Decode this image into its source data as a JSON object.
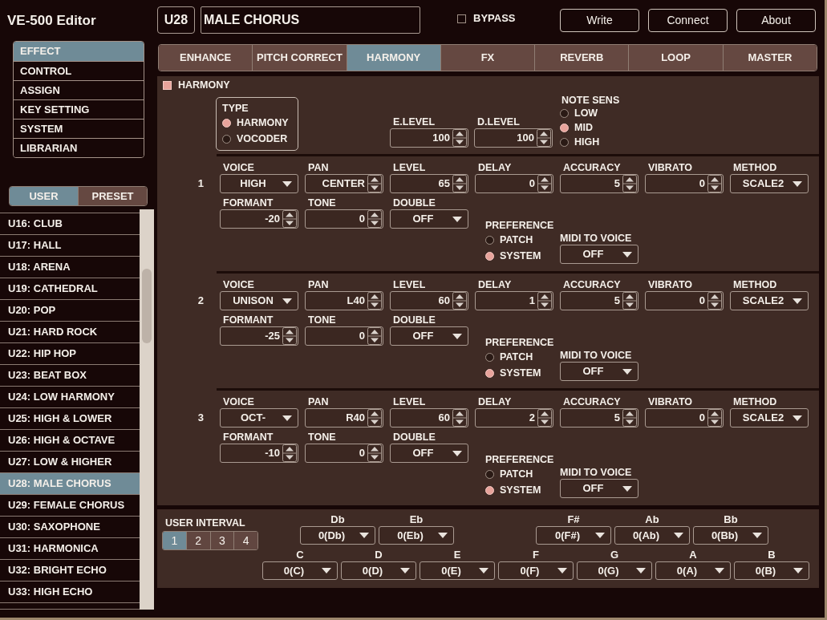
{
  "app": {
    "title": "VE-500 Editor"
  },
  "menu": [
    {
      "label": "EFFECT",
      "selected": true
    },
    {
      "label": "CONTROL",
      "selected": false
    },
    {
      "label": "ASSIGN",
      "selected": false
    },
    {
      "label": "KEY SETTING",
      "selected": false
    },
    {
      "label": "SYSTEM",
      "selected": false
    },
    {
      "label": "LIBRARIAN",
      "selected": false
    }
  ],
  "bank_tabs": [
    {
      "label": "USER",
      "selected": true
    },
    {
      "label": "PRESET",
      "selected": false
    }
  ],
  "patches": [
    {
      "label": "U16: CLUB",
      "selected": false
    },
    {
      "label": "U17: HALL",
      "selected": false
    },
    {
      "label": "U18: ARENA",
      "selected": false
    },
    {
      "label": "U19: CATHEDRAL",
      "selected": false
    },
    {
      "label": "U20: POP",
      "selected": false
    },
    {
      "label": "U21: HARD ROCK",
      "selected": false
    },
    {
      "label": "U22: HIP HOP",
      "selected": false
    },
    {
      "label": "U23: BEAT BOX",
      "selected": false
    },
    {
      "label": "U24: LOW HARMONY",
      "selected": false
    },
    {
      "label": "U25: HIGH & LOWER",
      "selected": false
    },
    {
      "label": "U26: HIGH & OCTAVE",
      "selected": false
    },
    {
      "label": "U27: LOW & HIGHER",
      "selected": false
    },
    {
      "label": "U28: MALE CHORUS",
      "selected": true
    },
    {
      "label": "U29: FEMALE CHORUS",
      "selected": false
    },
    {
      "label": "U30: SAXOPHONE",
      "selected": false
    },
    {
      "label": "U31: HARMONICA",
      "selected": false
    },
    {
      "label": "U32: BRIGHT ECHO",
      "selected": false
    },
    {
      "label": "U33: HIGH ECHO",
      "selected": false
    }
  ],
  "patch": {
    "number": "U28",
    "name": "MALE CHORUS"
  },
  "bypass": {
    "label": "BYPASS",
    "checked": false
  },
  "buttons": [
    "Write",
    "Connect",
    "About"
  ],
  "tabs": [
    {
      "label": "ENHANCE",
      "selected": false
    },
    {
      "label": "PITCH CORRECT",
      "selected": false
    },
    {
      "label": "HARMONY",
      "selected": true
    },
    {
      "label": "FX",
      "selected": false
    },
    {
      "label": "REVERB",
      "selected": false
    },
    {
      "label": "LOOP",
      "selected": false
    },
    {
      "label": "MASTER",
      "selected": false
    }
  ],
  "harmony": {
    "label": "HARMONY",
    "on": true,
    "type": {
      "label": "TYPE",
      "options": [
        {
          "label": "HARMONY",
          "selected": true
        },
        {
          "label": "VOCODER",
          "selected": false
        }
      ]
    },
    "e_level": {
      "label": "E.LEVEL",
      "value": "100"
    },
    "d_level": {
      "label": "D.LEVEL",
      "value": "100"
    },
    "note_sens": {
      "label": "NOTE SENS",
      "options": [
        {
          "label": "LOW",
          "selected": false
        },
        {
          "label": "MID",
          "selected": true
        },
        {
          "label": "HIGH",
          "selected": false
        }
      ]
    },
    "voices": [
      {
        "number": "1",
        "row_1": [
          {
            "label": "VOICE",
            "value": "HIGH",
            "kind": "dropdown"
          },
          {
            "label": "PAN",
            "value": "CENTER",
            "kind": "stepper"
          },
          {
            "label": "LEVEL",
            "value": "65",
            "kind": "stepper"
          },
          {
            "label": "DELAY",
            "value": "0",
            "kind": "stepper"
          },
          {
            "label": "ACCURACY",
            "value": "5",
            "kind": "stepper"
          },
          {
            "label": "VIBRATO",
            "value": "0",
            "kind": "stepper"
          },
          {
            "label": "METHOD",
            "value": "SCALE2",
            "kind": "dropdown"
          }
        ],
        "row_2": [
          {
            "label": "FORMANT",
            "value": "-20",
            "kind": "stepper"
          },
          {
            "label": "TONE",
            "value": "0",
            "kind": "stepper"
          },
          {
            "label": "DOUBLE",
            "value": "OFF",
            "kind": "dropdown"
          }
        ],
        "preference": {
          "label": "PREFERENCE",
          "options": [
            {
              "label": "PATCH",
              "selected": false
            },
            {
              "label": "SYSTEM",
              "selected": true
            }
          ]
        },
        "midi_to_voice": {
          "label": "MIDI TO VOICE",
          "value": "OFF"
        }
      },
      {
        "number": "2",
        "row_1": [
          {
            "label": "VOICE",
            "value": "UNISON",
            "kind": "dropdown"
          },
          {
            "label": "PAN",
            "value": "L40",
            "kind": "stepper"
          },
          {
            "label": "LEVEL",
            "value": "60",
            "kind": "stepper"
          },
          {
            "label": "DELAY",
            "value": "1",
            "kind": "stepper"
          },
          {
            "label": "ACCURACY",
            "value": "5",
            "kind": "stepper"
          },
          {
            "label": "VIBRATO",
            "value": "0",
            "kind": "stepper"
          },
          {
            "label": "METHOD",
            "value": "SCALE2",
            "kind": "dropdown"
          }
        ],
        "row_2": [
          {
            "label": "FORMANT",
            "value": "-25",
            "kind": "stepper"
          },
          {
            "label": "TONE",
            "value": "0",
            "kind": "stepper"
          },
          {
            "label": "DOUBLE",
            "value": "OFF",
            "kind": "dropdown"
          }
        ],
        "preference": {
          "label": "PREFERENCE",
          "options": [
            {
              "label": "PATCH",
              "selected": false
            },
            {
              "label": "SYSTEM",
              "selected": true
            }
          ]
        },
        "midi_to_voice": {
          "label": "MIDI TO VOICE",
          "value": "OFF"
        }
      },
      {
        "number": "3",
        "row_1": [
          {
            "label": "VOICE",
            "value": "OCT-",
            "kind": "dropdown"
          },
          {
            "label": "PAN",
            "value": "R40",
            "kind": "stepper"
          },
          {
            "label": "LEVEL",
            "value": "60",
            "kind": "stepper"
          },
          {
            "label": "DELAY",
            "value": "2",
            "kind": "stepper"
          },
          {
            "label": "ACCURACY",
            "value": "5",
            "kind": "stepper"
          },
          {
            "label": "VIBRATO",
            "value": "0",
            "kind": "stepper"
          },
          {
            "label": "METHOD",
            "value": "SCALE2",
            "kind": "dropdown"
          }
        ],
        "row_2": [
          {
            "label": "FORMANT",
            "value": "-10",
            "kind": "stepper"
          },
          {
            "label": "TONE",
            "value": "0",
            "kind": "stepper"
          },
          {
            "label": "DOUBLE",
            "value": "OFF",
            "kind": "dropdown"
          }
        ],
        "preference": {
          "label": "PREFERENCE",
          "options": [
            {
              "label": "PATCH",
              "selected": false
            },
            {
              "label": "SYSTEM",
              "selected": true
            }
          ]
        },
        "midi_to_voice": {
          "label": "MIDI TO VOICE",
          "value": "OFF"
        }
      }
    ]
  },
  "user_interval": {
    "label": "USER INTERVAL",
    "tabs": [
      {
        "label": "1",
        "selected": true
      },
      {
        "label": "2",
        "selected": false
      },
      {
        "label": "3",
        "selected": false
      },
      {
        "label": "4",
        "selected": false
      }
    ],
    "upper_keys": [
      {
        "label": "Db",
        "value": "0(Db)"
      },
      {
        "label": "Eb",
        "value": "0(Eb)"
      },
      {
        "label": "F#",
        "value": "0(F#)"
      },
      {
        "label": "Ab",
        "value": "0(Ab)"
      },
      {
        "label": "Bb",
        "value": "0(Bb)"
      }
    ],
    "lower_keys": [
      {
        "label": "C",
        "value": "0(C)"
      },
      {
        "label": "D",
        "value": "0(D)"
      },
      {
        "label": "E",
        "value": "0(E)"
      },
      {
        "label": "F",
        "value": "0(F)"
      },
      {
        "label": "G",
        "value": "0(G)"
      },
      {
        "label": "A",
        "value": "0(A)"
      },
      {
        "label": "B",
        "value": "0(B)"
      }
    ]
  }
}
